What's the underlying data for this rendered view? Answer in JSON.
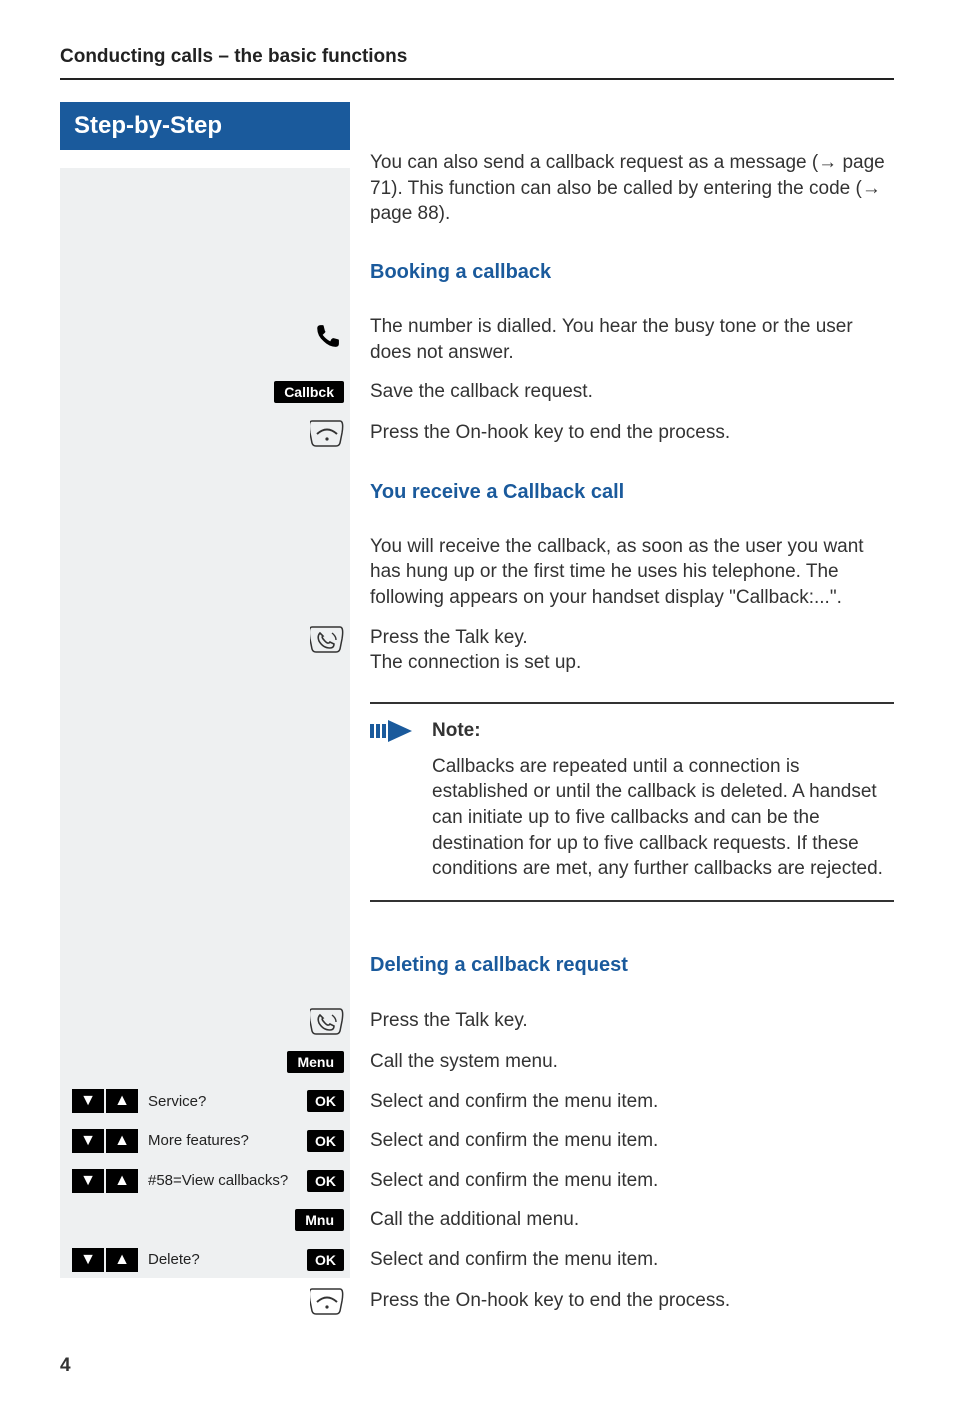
{
  "running_head": "Conducting calls – the basic functions",
  "banner": "Step-by-Step",
  "intro_text": "You can also send a callback request as a message (→ page 71). This function can also be called by entering the code (→ page 88).",
  "sections": {
    "booking": {
      "title": "Booking a callback",
      "row_dial": "The number is dialled. You hear the busy tone or the user does not answer.",
      "callbck_label": "Callbck",
      "row_save": "Save the callback request.",
      "row_onhook": "Press the On-hook key to end the process."
    },
    "receive": {
      "title": "You receive a Callback call",
      "intro": "You will receive the callback, as soon as the user you want has hung up or the first time he uses his telephone. The following appears on your handset display \"Callback:...\".",
      "row_talk": "Press the Talk key.\nThe connection is set up."
    },
    "note": {
      "heading": "Note:",
      "body": "Callbacks are repeated until a connection is established or until the callback is deleted. A handset can initiate up to five callbacks and can be the destination for up to five callback requests. If these conditions are met, any further callbacks are rejected."
    },
    "deleting": {
      "title": "Deleting a callback request",
      "row_talk": "Press the Talk key.",
      "menu_label": "Menu",
      "row_menu": "Call the system menu.",
      "items": [
        {
          "label": "Service?",
          "text": "Select and confirm the menu item."
        },
        {
          "label": "More features?",
          "text": "Select and confirm the menu item."
        },
        {
          "label": "#58=View callbacks?",
          "text": "Select and confirm the menu item."
        }
      ],
      "mnu_label": "Mnu",
      "row_mnu": "Call the additional menu.",
      "delete_item": {
        "label": "Delete?",
        "text": "Select and confirm the menu item."
      },
      "row_onhook": "Press the On-hook key to end the process."
    }
  },
  "ok_label": "OK",
  "page_number": "4"
}
